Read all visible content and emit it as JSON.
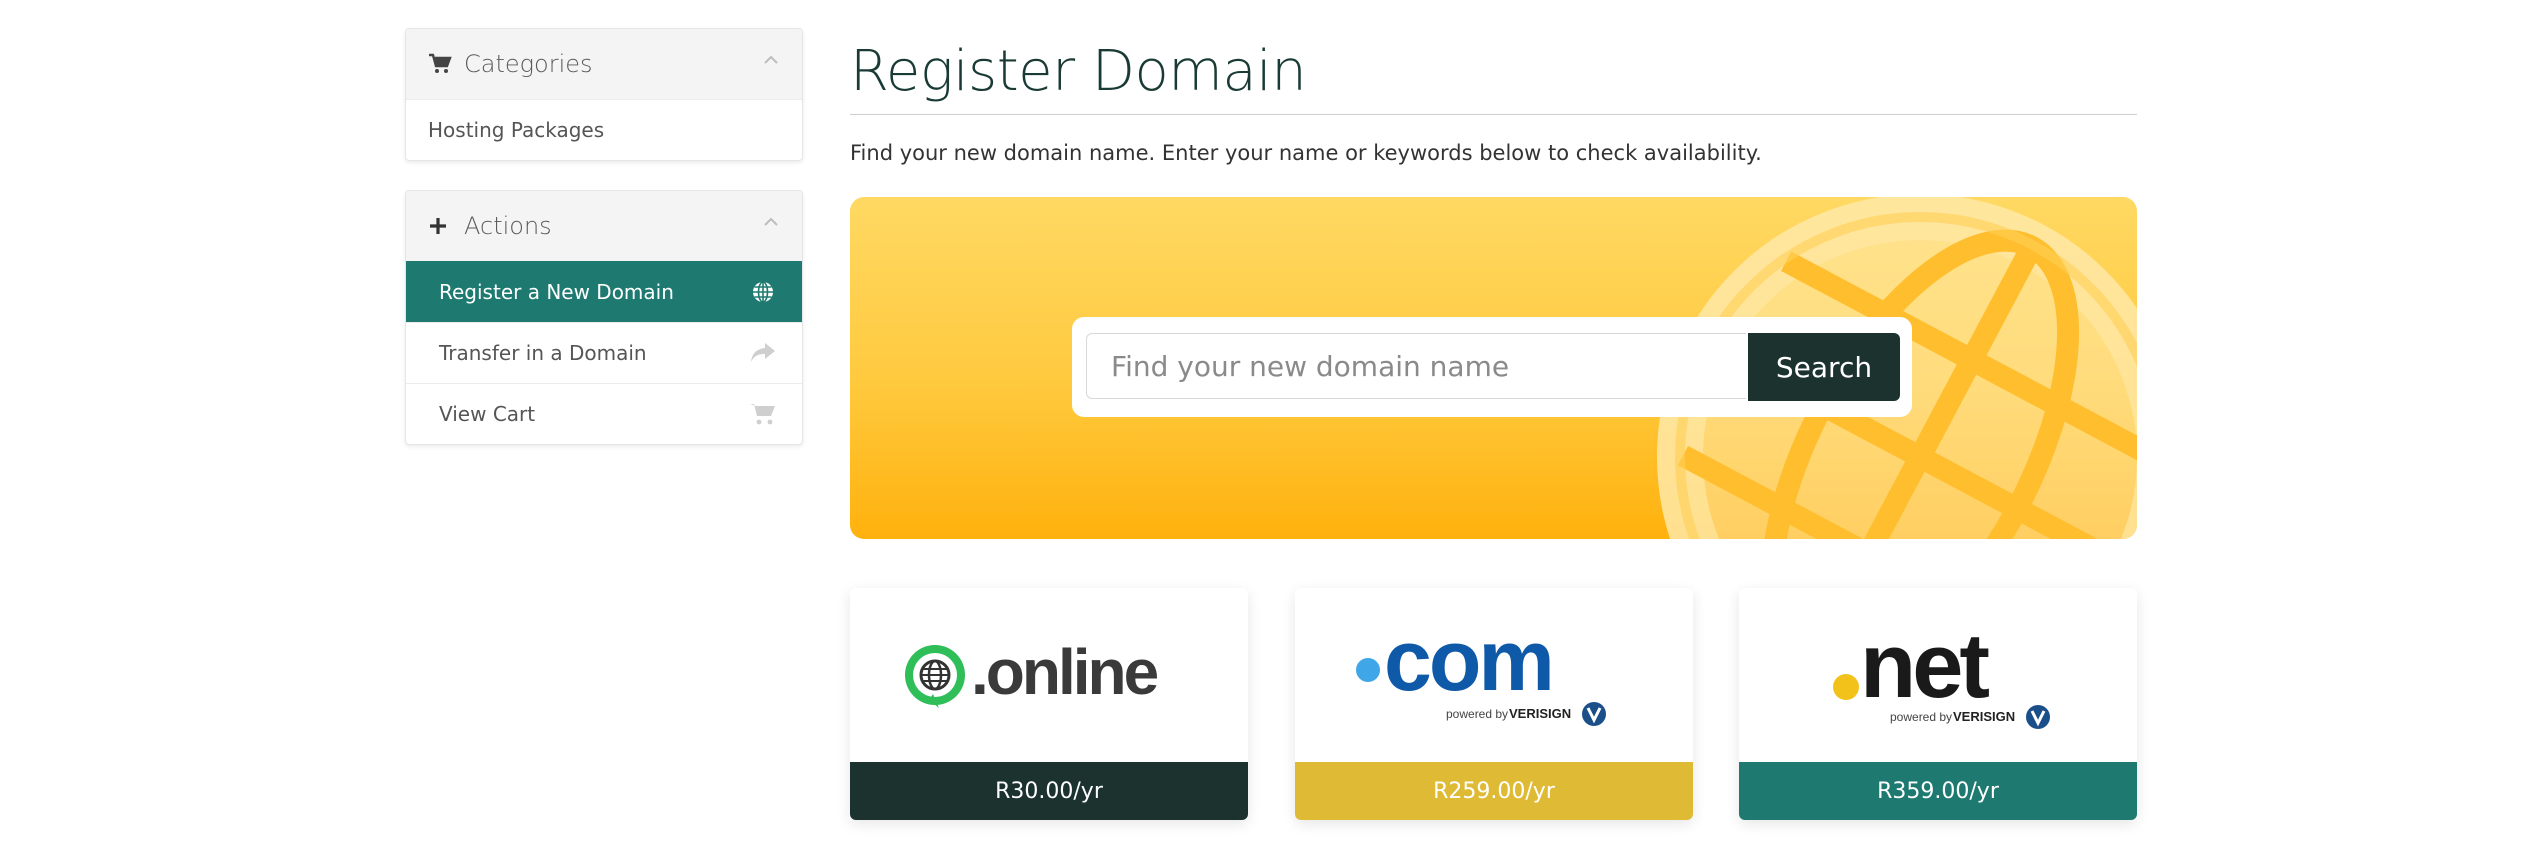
{
  "sidebar": {
    "categories": {
      "title": "Categories",
      "items": [
        {
          "label": "Hosting Packages"
        }
      ]
    },
    "actions": {
      "title": "Actions",
      "items": [
        {
          "label": "Register a New Domain",
          "icon": "globe-icon",
          "active": true
        },
        {
          "label": "Transfer in a Domain",
          "icon": "share-icon"
        },
        {
          "label": "View Cart",
          "icon": "cart-icon"
        }
      ]
    }
  },
  "main": {
    "title": "Register Domain",
    "subtitle": "Find your new domain name. Enter your name or keywords below to check availability.",
    "search": {
      "placeholder": "Find your new domain name",
      "button_label": "Search"
    },
    "tlds": [
      {
        "name": ".online",
        "price": "R30.00/yr",
        "color": "#1b322f"
      },
      {
        "name": ".com",
        "tagline_prefix": "powered by",
        "tagline_brand": "VERISIGN",
        "price": "R259.00/yr",
        "color": "#dfbb35"
      },
      {
        "name": ".net",
        "tagline_prefix": "powered by",
        "tagline_brand": "VERISIGN",
        "price": "R359.00/yr",
        "color": "#1e7a70"
      }
    ]
  },
  "colors": {
    "accent": "#1e7a70",
    "dark": "#1b322f",
    "hero_top": "#ffd963",
    "hero_bottom": "#ffb10d"
  }
}
